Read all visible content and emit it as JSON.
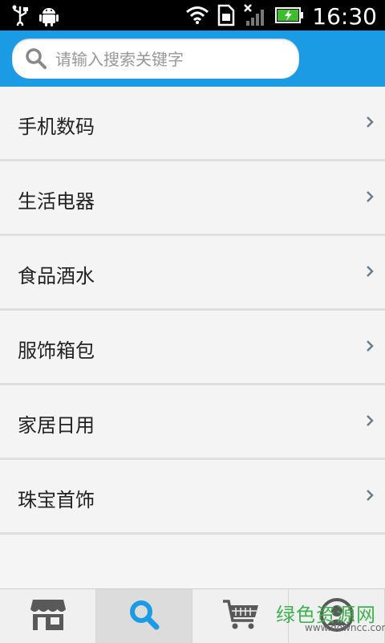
{
  "status_bar": {
    "time": "16:30",
    "icons": [
      "usb-icon",
      "android-debug-icon",
      "wifi-icon",
      "sim-icon",
      "no-signal-icon",
      "battery-charging-icon"
    ]
  },
  "search": {
    "placeholder": "请输入搜索关键字",
    "value": ""
  },
  "categories": [
    {
      "label": "手机数码"
    },
    {
      "label": "生活电器"
    },
    {
      "label": "食品酒水"
    },
    {
      "label": "服饰箱包"
    },
    {
      "label": "家居日用"
    },
    {
      "label": "珠宝首饰"
    }
  ],
  "bottom_nav": {
    "tabs": [
      {
        "icon": "store-icon",
        "active": false
      },
      {
        "icon": "search-icon",
        "active": true
      },
      {
        "icon": "cart-icon",
        "active": false
      },
      {
        "icon": "user-icon",
        "active": false
      }
    ]
  },
  "watermark": {
    "text": "绿色资源网",
    "subtext": "www.downcc.com"
  },
  "colors": {
    "header": "#1b9be3",
    "active_tab_icon": "#1b9be3"
  }
}
